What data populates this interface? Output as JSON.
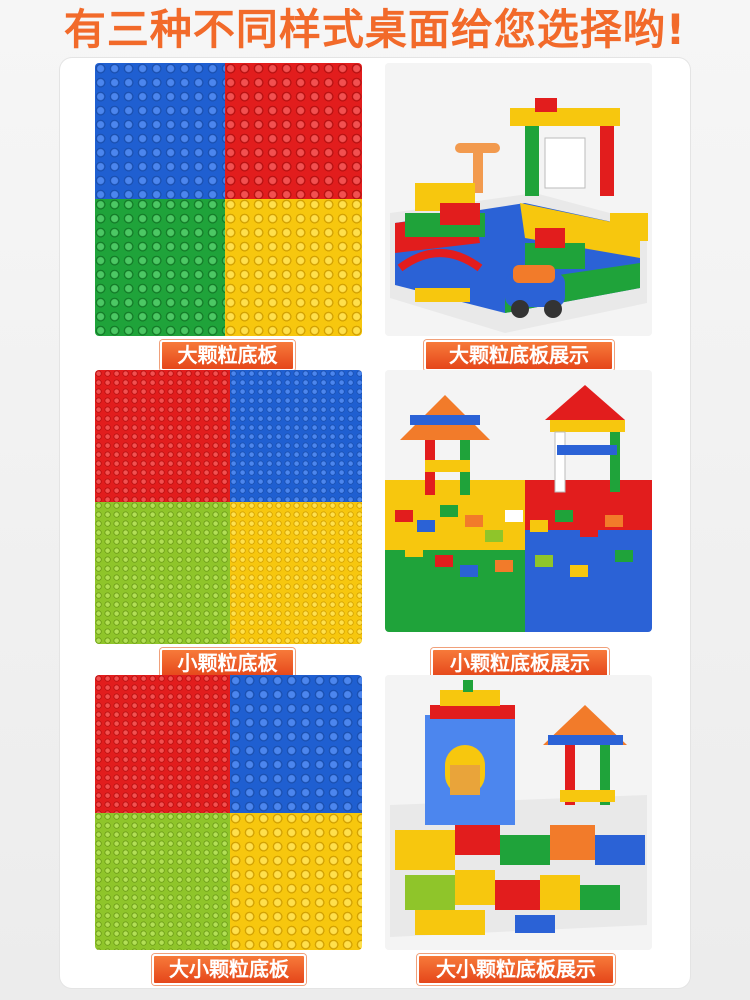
{
  "headline": "有三种不同样式桌面给您选择哟!",
  "rows": [
    {
      "plate_label": "大颗粒底板",
      "demo_label": "大颗粒底板展示"
    },
    {
      "plate_label": "小颗粒底板",
      "demo_label": "小颗粒底板展示"
    },
    {
      "plate_label": "大小颗粒底板",
      "demo_label": "大小颗粒底板展示"
    }
  ],
  "colors": {
    "headline": "#f26a2a",
    "label_bg": "#ea5420",
    "plate_blue": "#1f5fd1",
    "plate_red": "#e21d1d",
    "plate_green": "#1fa33a",
    "plate_lime": "#8fc52a",
    "plate_yellow": "#f7c70e"
  }
}
